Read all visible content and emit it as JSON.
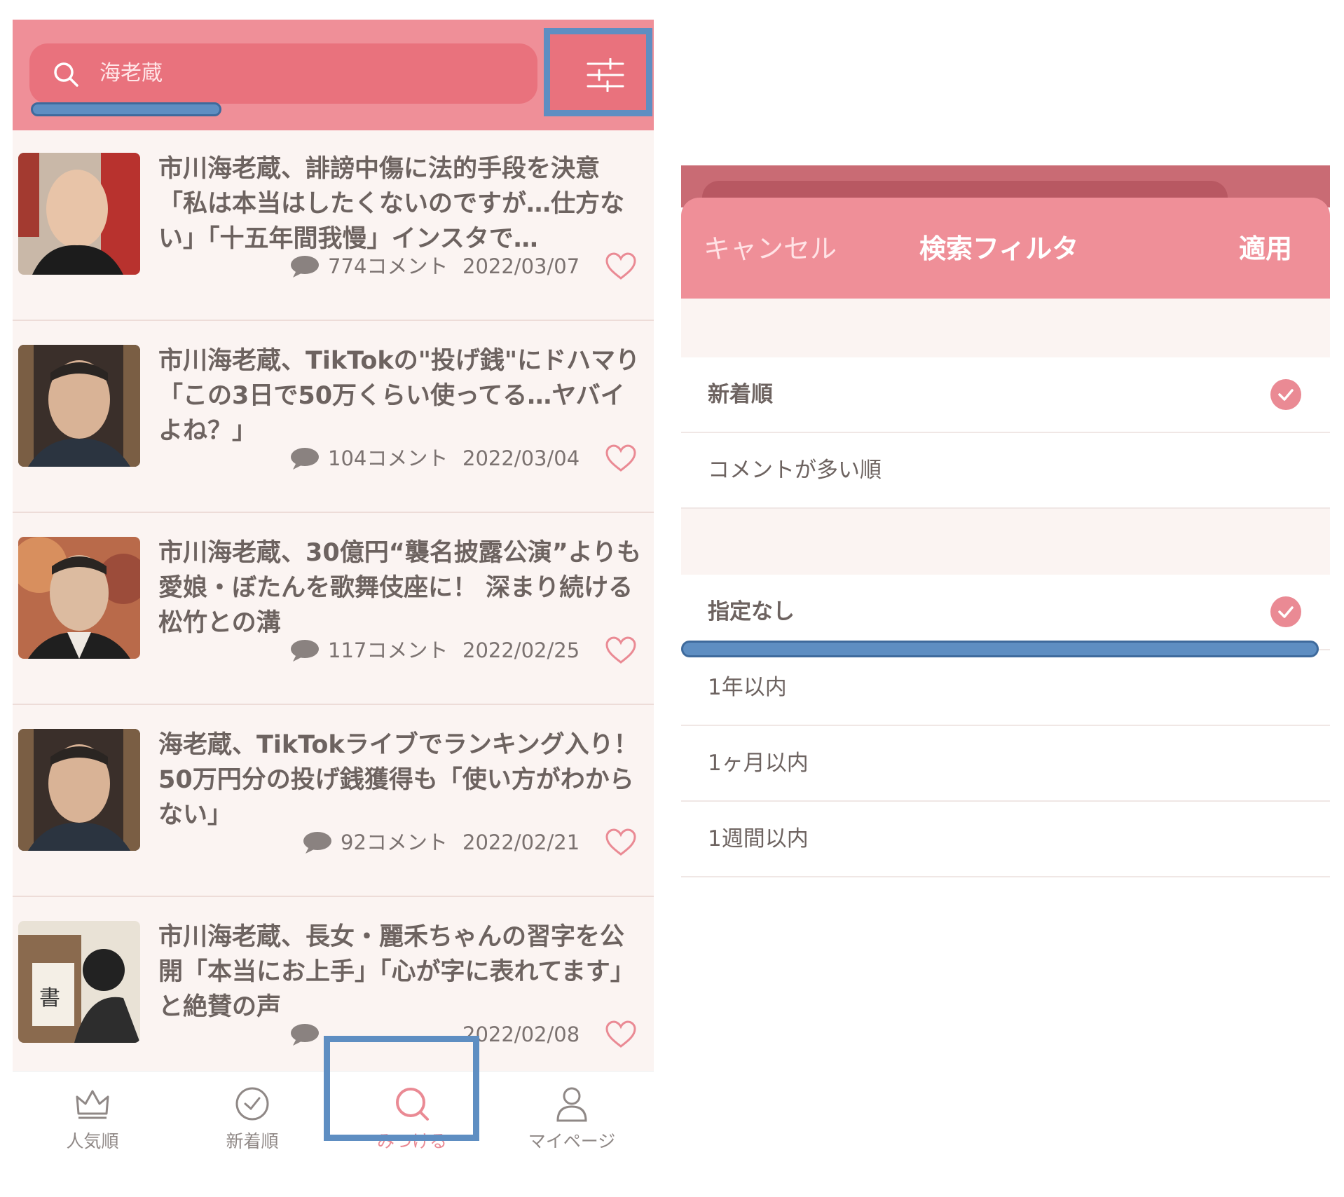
{
  "left": {
    "search": {
      "query": "海老蔵"
    },
    "articles": [
      {
        "title": "市川海老蔵、誹謗中傷に法的手段を決意「私は本当はしたくないのですが…仕方ない」「十五年間我慢」インスタで…",
        "comments": "774コメント",
        "date": "2022/03/07"
      },
      {
        "title": "市川海老蔵、TikTokの\"投げ銭\"にドハマり「この3日で50万くらい使ってる…ヤバイよね？」",
        "comments": "104コメント",
        "date": "2022/03/04"
      },
      {
        "title": "市川海老蔵、30億円“襲名披露公演”よりも愛娘・ぼたんを歌舞伎座に！ 深まり続ける松竹との溝",
        "comments": "117コメント",
        "date": "2022/02/25"
      },
      {
        "title": "海老蔵、TikTokライブでランキング入り！ 50万円分の投げ銭獲得も「使い方がわからない」",
        "comments": "92コメント",
        "date": "2022/02/21"
      },
      {
        "title": "市川海老蔵、長女・麗禾ちゃんの習字を公開「本当にお上手」「心が字に表れてます」と絶賛の声",
        "comments": "",
        "date": "2022/02/08"
      }
    ],
    "tabs": [
      {
        "label": "人気順",
        "icon": "crown-icon"
      },
      {
        "label": "新着順",
        "icon": "clock-check-icon"
      },
      {
        "label": "みつける",
        "icon": "search-icon",
        "active": true
      },
      {
        "label": "マイページ",
        "icon": "person-icon"
      }
    ]
  },
  "right": {
    "header": {
      "cancel": "キャンセル",
      "title": "検索フィルタ",
      "apply": "適用"
    },
    "sort_options": [
      {
        "label": "新着順",
        "selected": true
      },
      {
        "label": "コメントが多い順",
        "selected": false
      }
    ],
    "period_options": [
      {
        "label": "指定なし",
        "selected": true
      },
      {
        "label": "1年以内",
        "selected": false
      },
      {
        "label": "1ヶ月以内",
        "selected": false
      },
      {
        "label": "1週間以内",
        "selected": false
      }
    ]
  },
  "colors": {
    "brand_pink": "#ef8f98",
    "search_bar": "#e9727d",
    "highlight_blue": "#5e8ec2",
    "background": "#fbf4f2"
  }
}
